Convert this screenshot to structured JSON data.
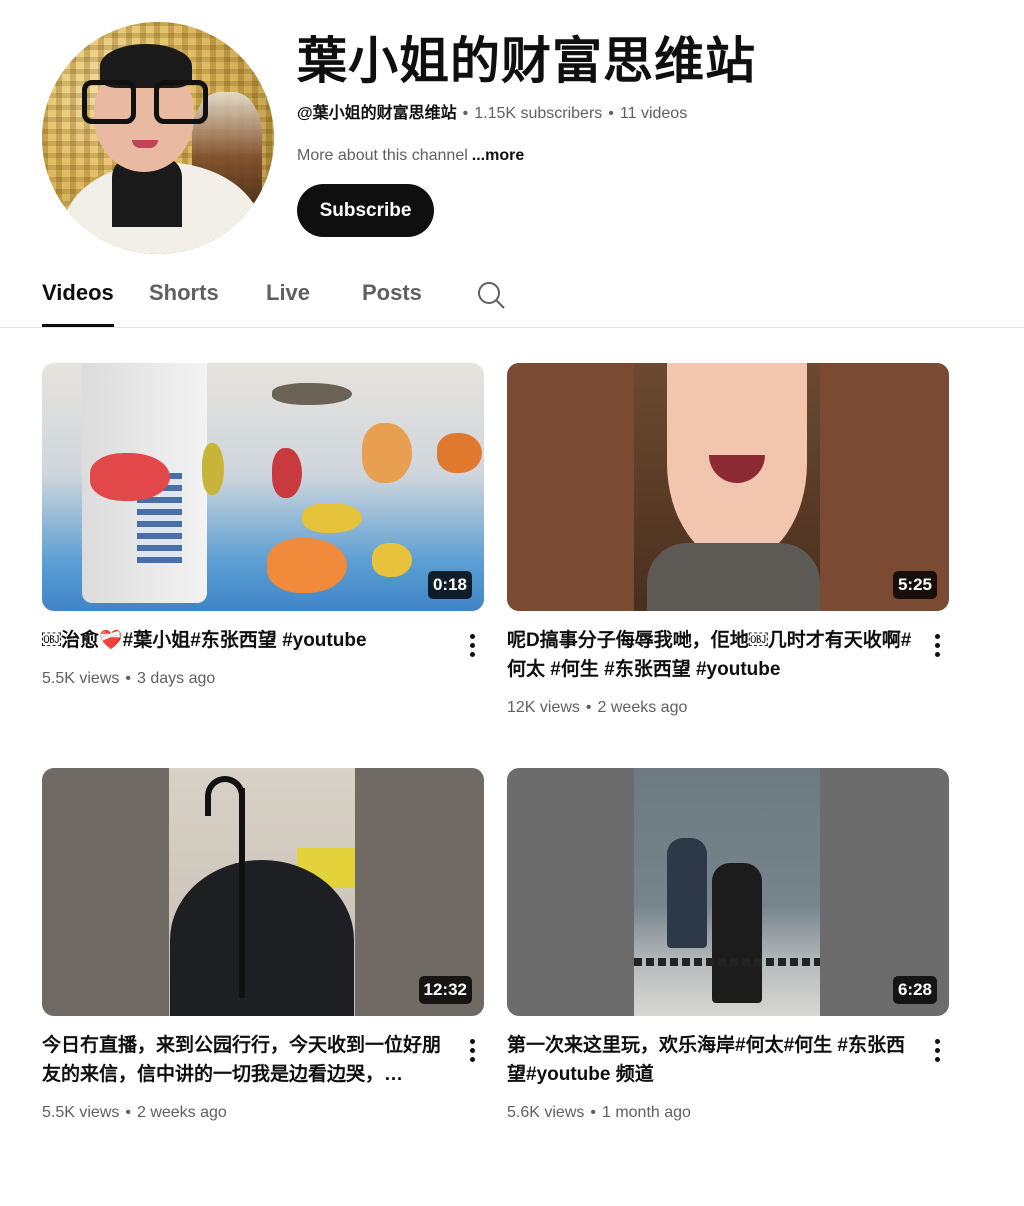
{
  "channel": {
    "name": "葉小姐的财富思维站",
    "handle": "@葉小姐的财富思维站",
    "subscribers": "1.15K subscribers",
    "video_count": "11 videos",
    "about_text": "More about this channel",
    "about_more": "...more",
    "subscribe_label": "Subscribe"
  },
  "tabs": [
    {
      "label": "Videos",
      "active": true
    },
    {
      "label": "Shorts",
      "active": false
    },
    {
      "label": "Live",
      "active": false
    },
    {
      "label": "Posts",
      "active": false
    }
  ],
  "search_icon": "search-icon",
  "videos": [
    {
      "title": "￼治愈❤️‍🩹#葉小姐#东张西望 #youtube",
      "duration": "0:18",
      "views": "5.5K views",
      "age": "3 days ago"
    },
    {
      "title": "呢D搞事分子侮辱我哋，佢地￼几时才有天收啊#何太 #何生 #东张西望 #youtube",
      "duration": "5:25",
      "views": "12K views",
      "age": "2 weeks ago"
    },
    {
      "title": "今日冇直播，来到公园行行，今天收到一位好朋友的来信，信中讲的一切我是边看边哭，…",
      "duration": "12:32",
      "views": "5.5K views",
      "age": "2 weeks ago"
    },
    {
      "title": "第一次来这里玩，欢乐海岸#何太#何生 #东张西望#youtube 频道",
      "duration": "6:28",
      "views": "5.6K views",
      "age": "1 month ago"
    }
  ],
  "separator": "•"
}
